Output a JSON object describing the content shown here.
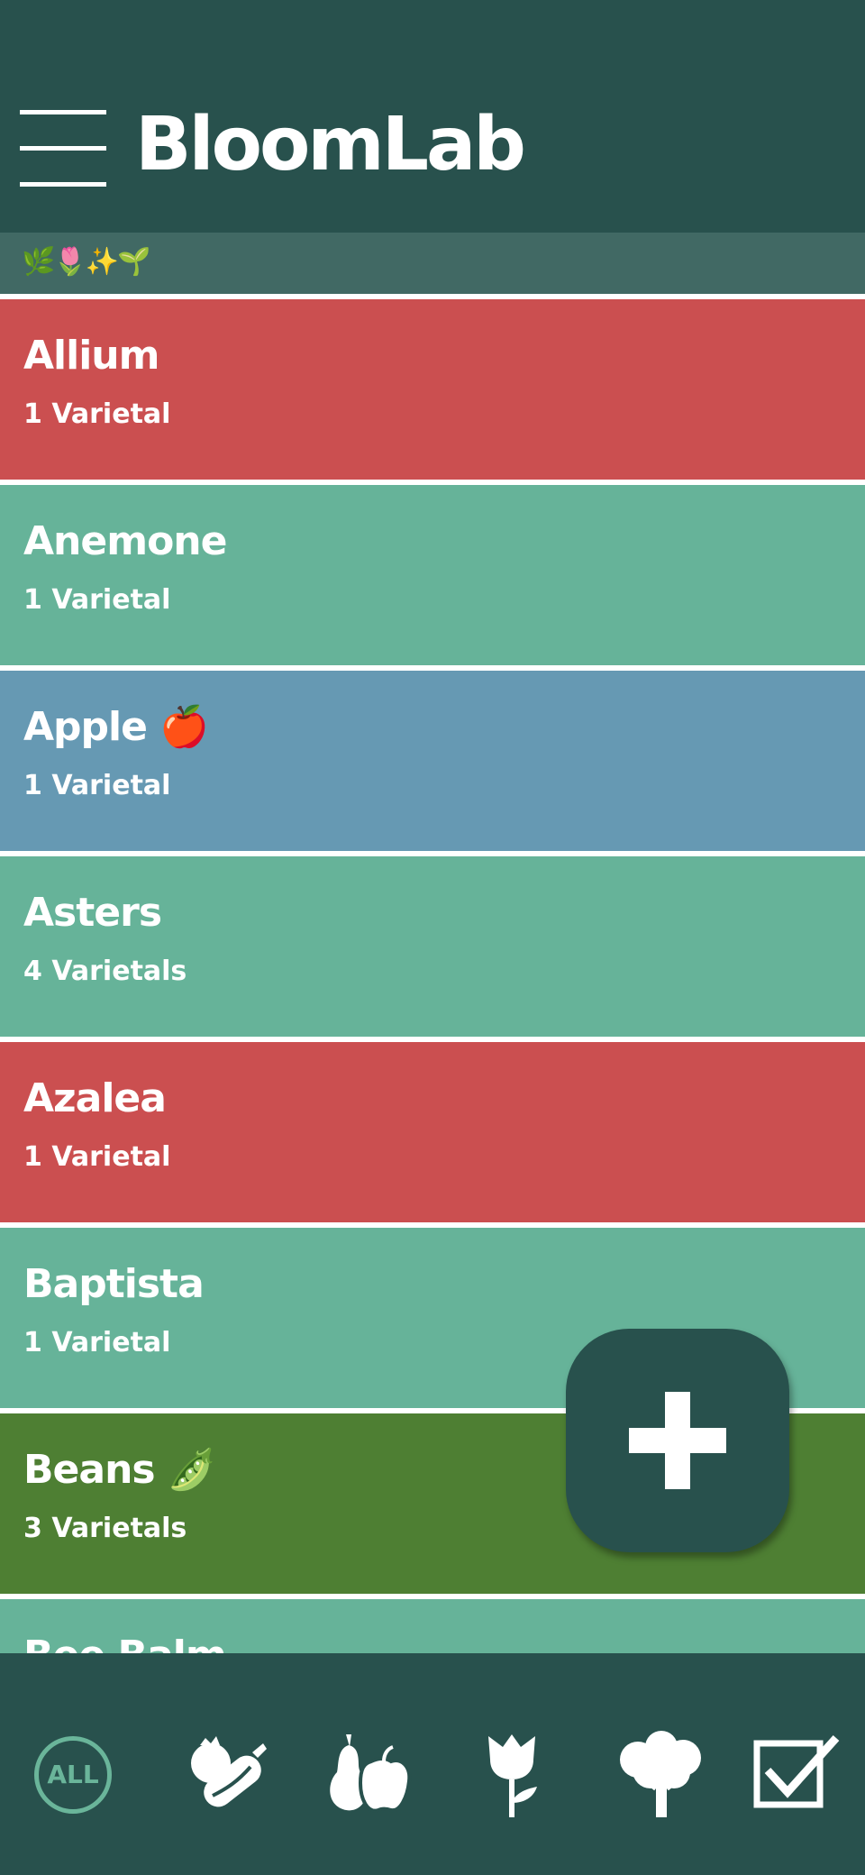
{
  "header": {
    "title": "BloomLab",
    "emoji_bar": "🌿🌷✨🌱"
  },
  "colors": {
    "header_bg": "#28514d",
    "subbar_bg": "#416964",
    "red": "#cb4f50",
    "teal": "#66b399",
    "blue": "#6699b3",
    "green": "#4e7f33",
    "fab_bg": "#28514d",
    "nav_all": "#6ab59a"
  },
  "plants": [
    {
      "name": "Allium",
      "count": "1 Varietal",
      "color": "#cb4f50"
    },
    {
      "name": "Anemone",
      "count": "1 Varietal",
      "color": "#66b399"
    },
    {
      "name": "Apple 🍎",
      "count": "1 Varietal",
      "color": "#6699b3"
    },
    {
      "name": "Asters",
      "count": "4 Varietals",
      "color": "#66b399"
    },
    {
      "name": "Azalea",
      "count": "1 Varietal",
      "color": "#cb4f50"
    },
    {
      "name": "Baptista",
      "count": "1 Varietal",
      "color": "#66b399"
    },
    {
      "name": "Beans 🫛",
      "count": "3 Varietals",
      "color": "#4e7f33"
    },
    {
      "name": "Bee Balm",
      "count": "",
      "color": "#66b399"
    }
  ],
  "nav": {
    "all_label": "ALL",
    "items": [
      "all-filter",
      "vegetables-icon",
      "fruits-icon",
      "flowers-icon",
      "trees-icon",
      "tasks-checkbox-icon"
    ]
  }
}
